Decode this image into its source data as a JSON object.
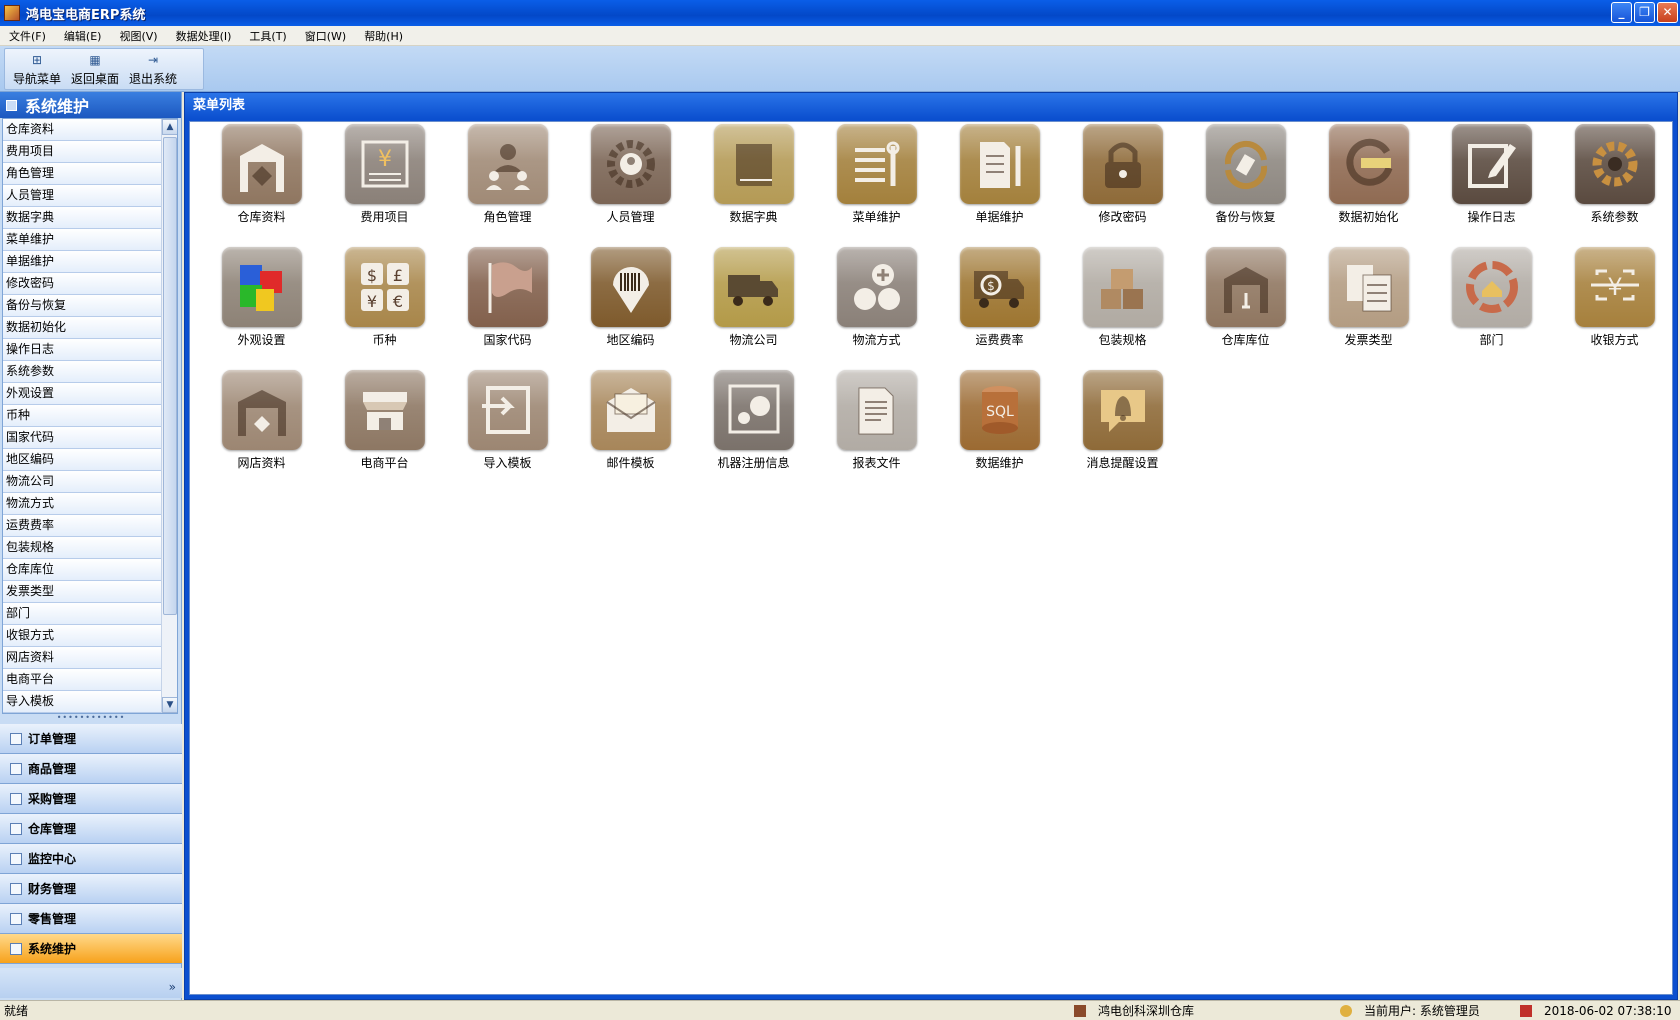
{
  "window": {
    "title": "鸿电宝电商ERP系统",
    "btn_min": "_",
    "btn_max": "❐",
    "btn_close": "✕"
  },
  "menus": [
    "文件(F)",
    "编辑(E)",
    "视图(V)",
    "数据处理(I)",
    "工具(T)",
    "窗口(W)",
    "帮助(H)"
  ],
  "toolbar": {
    "nav_menu": "导航菜单",
    "back_desktop": "返回桌面",
    "exit_system": "退出系统"
  },
  "sidebar": {
    "header": "系统维护",
    "items": [
      "仓库资料",
      "费用项目",
      "角色管理",
      "人员管理",
      "数据字典",
      "菜单维护",
      "单据维护",
      "修改密码",
      "备份与恢复",
      "数据初始化",
      "操作日志",
      "系统参数",
      "外观设置",
      "币种",
      "国家代码",
      "地区编码",
      "物流公司",
      "物流方式",
      "运费费率",
      "包装规格",
      "仓库库位",
      "发票类型",
      "部门",
      "收银方式",
      "网店资料",
      "电商平台",
      "导入模板"
    ],
    "modules": [
      "订单管理",
      "商品管理",
      "采购管理",
      "仓库管理",
      "监控中心",
      "财务管理",
      "零售管理",
      "系统维护"
    ],
    "active_module": "系统维护"
  },
  "main": {
    "header": "菜单列表",
    "tiles": [
      {
        "label": "仓库资料",
        "icon": "warehouse-icon",
        "color": "#8f7660"
      },
      {
        "label": "费用项目",
        "icon": "expense-yen-icon",
        "color": "#8a8078"
      },
      {
        "label": "角色管理",
        "icon": "role-users-icon",
        "color": "#a08a76"
      },
      {
        "label": "人员管理",
        "icon": "personnel-gear-icon",
        "color": "#7b6555"
      },
      {
        "label": "数据字典",
        "icon": "dictionary-book-icon",
        "color": "#b49a55"
      },
      {
        "label": "菜单维护",
        "icon": "menu-wrench-icon",
        "color": "#a3803c"
      },
      {
        "label": "单据维护",
        "icon": "document-wrench-icon",
        "color": "#a3803c"
      },
      {
        "label": "修改密码",
        "icon": "padlock-icon",
        "color": "#8e6a38"
      },
      {
        "label": "备份与恢复",
        "icon": "backup-restore-icon",
        "color": "#8d8780"
      },
      {
        "label": "数据初始化",
        "icon": "data-init-icon",
        "color": "#8f6a52"
      },
      {
        "label": "操作日志",
        "icon": "operation-log-icon",
        "color": "#5a4a3f"
      },
      {
        "label": "系统参数",
        "icon": "system-gear-icon",
        "color": "#5a4a3f"
      },
      {
        "label": "外观设置",
        "icon": "appearance-colors-icon",
        "color": "#8d8276"
      },
      {
        "label": "币种",
        "icon": "currency-symbols-icon",
        "color": "#a8864a"
      },
      {
        "label": "国家代码",
        "icon": "country-flag-icon",
        "color": "#82604c"
      },
      {
        "label": "地区编码",
        "icon": "region-barcode-pin-icon",
        "color": "#7e5a2c"
      },
      {
        "label": "物流公司",
        "icon": "logistics-truck-icon",
        "color": "#b39a48"
      },
      {
        "label": "物流方式",
        "icon": "shipping-methods-icon",
        "color": "#8a8078"
      },
      {
        "label": "运费费率",
        "icon": "freight-rate-truck-icon",
        "color": "#9d7530"
      },
      {
        "label": "包装规格",
        "icon": "packaging-boxes-icon",
        "color": "#b0aaa2"
      },
      {
        "label": "仓库库位",
        "icon": "warehouse-location-icon",
        "color": "#8f7660"
      },
      {
        "label": "发票类型",
        "icon": "invoice-type-icon",
        "color": "#b39c82"
      },
      {
        "label": "部门",
        "icon": "department-home-icon",
        "color": "#b1aba4"
      },
      {
        "label": "收银方式",
        "icon": "cashier-yen-icon",
        "color": "#a6803c"
      },
      {
        "label": "网店资料",
        "icon": "online-store-icon",
        "color": "#9c8672"
      },
      {
        "label": "电商平台",
        "icon": "ecommerce-shop-icon",
        "color": "#8d7763"
      },
      {
        "label": "导入模板",
        "icon": "import-template-icon",
        "color": "#9c8672"
      },
      {
        "label": "邮件模板",
        "icon": "mail-template-icon",
        "color": "#a7865a"
      },
      {
        "label": "机器注册信息",
        "icon": "machine-register-icon",
        "color": "#7a716a"
      },
      {
        "label": "报表文件",
        "icon": "report-file-icon",
        "color": "#b1aba4"
      },
      {
        "label": "数据维护",
        "icon": "sql-database-icon",
        "color": "#9b6a32"
      },
      {
        "label": "消息提醒设置",
        "icon": "notification-bell-icon",
        "color": "#8e6a38"
      }
    ]
  },
  "status": {
    "ready": "就绪",
    "warehouse": "鸿电创科深圳仓库",
    "user": "当前用户: 系统管理员",
    "datetime": "2018-06-02 07:38:10"
  }
}
